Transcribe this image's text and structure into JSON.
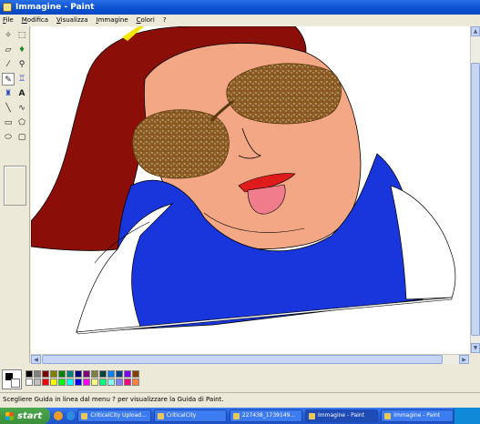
{
  "window": {
    "title": "Immagine - Paint"
  },
  "menu": [
    "File",
    "Modifica",
    "Visualizza",
    "Immagine",
    "Colori",
    "?"
  ],
  "tools": [
    {
      "name": "free-select-icon",
      "glyph": "✧"
    },
    {
      "name": "rect-select-icon",
      "glyph": "⬚"
    },
    {
      "name": "eraser-icon",
      "glyph": "▱"
    },
    {
      "name": "fill-icon",
      "glyph": "♦"
    },
    {
      "name": "color-picker-icon",
      "glyph": "⁄"
    },
    {
      "name": "magnifier-icon",
      "glyph": "⚲"
    },
    {
      "name": "pencil-icon",
      "glyph": "✎"
    },
    {
      "name": "brush-icon",
      "glyph": "♖"
    },
    {
      "name": "airbrush-icon",
      "glyph": "♜"
    },
    {
      "name": "text-icon",
      "glyph": "A"
    },
    {
      "name": "line-icon",
      "glyph": "╲"
    },
    {
      "name": "curve-icon",
      "glyph": "∿"
    },
    {
      "name": "rectangle-icon",
      "glyph": "▭"
    },
    {
      "name": "polygon-icon",
      "glyph": "⬠"
    },
    {
      "name": "ellipse-icon",
      "glyph": "⬭"
    },
    {
      "name": "rounded-rect-icon",
      "glyph": "▢"
    }
  ],
  "palette": {
    "foreground": "#000000",
    "background": "#ffffff",
    "colors": [
      "#000000",
      "#808080",
      "#800000",
      "#808000",
      "#008000",
      "#008080",
      "#000080",
      "#800080",
      "#808040",
      "#004040",
      "#0080ff",
      "#004080",
      "#8000ff",
      "#804000",
      "#ffffff",
      "#c0c0c0",
      "#ff0000",
      "#ffff00",
      "#00ff00",
      "#00ffff",
      "#0000ff",
      "#ff00ff",
      "#ffff80",
      "#00ff80",
      "#80ffff",
      "#8080ff",
      "#ff0080",
      "#ff8040"
    ]
  },
  "status": {
    "text": "Scegliere Guida in linea dal menu ? per visualizzare la Guida di Paint."
  },
  "taskbar": {
    "start_label": "start",
    "tasks": [
      {
        "label": "CriticalCity Upload..."
      },
      {
        "label": "CriticalCity"
      },
      {
        "label": "227438_1739149..."
      },
      {
        "label": "Immagine - Paint"
      },
      {
        "label": "Immagine - Paint"
      }
    ]
  }
}
